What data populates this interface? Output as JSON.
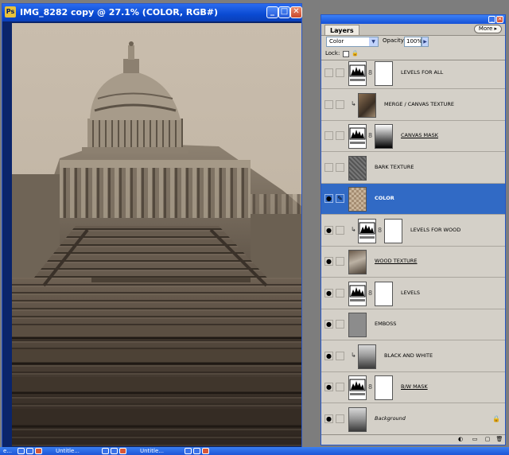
{
  "document": {
    "title": "IMG_8282 copy @ 27.1% (COLOR, RGB#)",
    "app_icon": "Ps",
    "buttons": {
      "minimize": "_",
      "maximize": "□",
      "close": "✕"
    }
  },
  "layers_panel": {
    "tab_label": "Layers",
    "more_label": "More ▸",
    "blend_mode": "Color",
    "opacity_label": "Opacity:",
    "opacity_value": "100%",
    "lock_label": "Lock:",
    "layers": [
      {
        "name": "LEVELS FOR ALL",
        "visible": false,
        "kind": "adjustment",
        "has_mask": true,
        "clipped": false,
        "selected": false,
        "underline": false,
        "italic": false
      },
      {
        "name": "MERGE / CANVAS TEXTURE",
        "visible": false,
        "kind": "photo",
        "has_mask": false,
        "clipped": true,
        "selected": false,
        "underline": false,
        "italic": false
      },
      {
        "name": "CANVAS MASK",
        "visible": false,
        "kind": "adjustment",
        "has_mask": true,
        "mask_style": "gradient",
        "clipped": false,
        "selected": false,
        "underline": true,
        "italic": false
      },
      {
        "name": "BARK TEXTURE",
        "visible": false,
        "kind": "texture",
        "has_mask": false,
        "clipped": false,
        "selected": false,
        "underline": false,
        "italic": false
      },
      {
        "name": "COLOR",
        "visible": true,
        "kind": "color-fill",
        "has_mask": false,
        "clipped": false,
        "selected": true,
        "underline": false,
        "italic": false
      },
      {
        "name": "LEVELS FOR WOOD",
        "visible": true,
        "kind": "adjustment",
        "has_mask": true,
        "clipped": true,
        "selected": false,
        "underline": false,
        "italic": false
      },
      {
        "name": "WOOD TEXTURE",
        "visible": true,
        "kind": "wood",
        "has_mask": false,
        "clipped": false,
        "selected": false,
        "underline": true,
        "italic": false
      },
      {
        "name": "LEVELS",
        "visible": true,
        "kind": "adjustment",
        "has_mask": true,
        "clipped": false,
        "selected": false,
        "underline": false,
        "italic": false
      },
      {
        "name": "EMBOSS",
        "visible": true,
        "kind": "emboss",
        "has_mask": false,
        "clipped": false,
        "selected": false,
        "underline": false,
        "italic": false
      },
      {
        "name": "BLACK AND WHITE",
        "visible": true,
        "kind": "bw-photo",
        "has_mask": false,
        "clipped": true,
        "selected": false,
        "underline": false,
        "italic": false
      },
      {
        "name": "B/W MASK",
        "visible": true,
        "kind": "adjustment",
        "has_mask": true,
        "clipped": false,
        "selected": false,
        "underline": true,
        "italic": false
      },
      {
        "name": "Background",
        "visible": true,
        "kind": "bw-photo",
        "has_mask": false,
        "clipped": false,
        "selected": false,
        "underline": false,
        "italic": true,
        "locked": true
      }
    ],
    "footer_icons": [
      "adjustment-icon",
      "folder-icon",
      "new-layer-icon",
      "trash-icon"
    ]
  },
  "taskbar": {
    "items": [
      {
        "label": "e..."
      },
      {
        "label": "Untitle..."
      },
      {
        "label": "Untitle..."
      }
    ]
  },
  "colors": {
    "selection": "#316ac5",
    "titlebar": "#0a4ad2",
    "panel_bg": "#d4d0c8"
  }
}
